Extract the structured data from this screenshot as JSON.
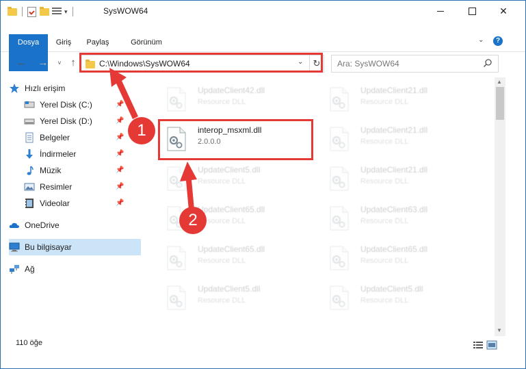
{
  "window": {
    "title": "SysWOW64",
    "controls": {
      "minimize": "minimize",
      "maximize": "maximize",
      "close": "✕"
    }
  },
  "ribbon": {
    "tabs": [
      "Dosya",
      "Giriş",
      "Paylaş",
      "Görünüm"
    ],
    "help": "?"
  },
  "navbar": {
    "address": "C:\\Windows\\SysWOW64",
    "search_placeholder": "Ara: SysWOW64"
  },
  "navpane": {
    "items": [
      {
        "label": "Hızlı erişim",
        "icon": "star-icon",
        "pinned": false
      },
      {
        "label": "Yerel Disk (C:)",
        "icon": "drive-icon",
        "pinned": true
      },
      {
        "label": "Yerel Disk (D:)",
        "icon": "drive-icon",
        "pinned": true
      },
      {
        "label": "Belgeler",
        "icon": "documents-icon",
        "pinned": true
      },
      {
        "label": "İndirmeler",
        "icon": "download-icon",
        "pinned": true
      },
      {
        "label": "Müzik",
        "icon": "music-icon",
        "pinned": true
      },
      {
        "label": "Resimler",
        "icon": "pictures-icon",
        "pinned": true
      },
      {
        "label": "Videolar",
        "icon": "video-icon",
        "pinned": true
      },
      {
        "label": "OneDrive",
        "icon": "cloud-icon",
        "pinned": false
      },
      {
        "label": "Bu bilgisayar",
        "icon": "computer-icon",
        "pinned": false,
        "selected": true
      },
      {
        "label": "Ağ",
        "icon": "network-icon",
        "pinned": false
      }
    ]
  },
  "files": [
    {
      "name": "UpdateClient42.dll",
      "desc": "Resource DLL",
      "faded": true
    },
    {
      "name": "UpdateClient21.dll",
      "desc": "Resource DLL",
      "faded": true
    },
    {
      "name": "interop_msxml.dll",
      "desc": "2.0.0.0",
      "faded": false
    },
    {
      "name": "UpdateClient21.dll",
      "desc": "Resource DLL",
      "faded": true
    },
    {
      "name": "UpdateClient5.dll",
      "desc": "Resource DLL",
      "faded": true
    },
    {
      "name": "UpdateClient21.dll",
      "desc": "Resource DLL",
      "faded": true
    },
    {
      "name": "UpdateClient65.dll",
      "desc": "Resource DLL",
      "faded": true
    },
    {
      "name": "UpdateClient63.dll",
      "desc": "Resource DLL",
      "faded": true
    },
    {
      "name": "UpdateClient65.dll",
      "desc": "Resource DLL",
      "faded": true
    },
    {
      "name": "UpdateClient65.dll",
      "desc": "Resource DLL",
      "faded": true
    },
    {
      "name": "UpdateClient5.dll",
      "desc": "Resource DLL",
      "faded": true
    },
    {
      "name": "UpdateClient5.dll",
      "desc": "Resource DLL",
      "faded": true
    }
  ],
  "status": {
    "item_count": "110 öğe"
  },
  "annotations": {
    "step1": "1",
    "step2": "2",
    "color": "#e53935"
  },
  "colors": {
    "accent": "#1a73c8",
    "selection": "#cce4f7"
  }
}
